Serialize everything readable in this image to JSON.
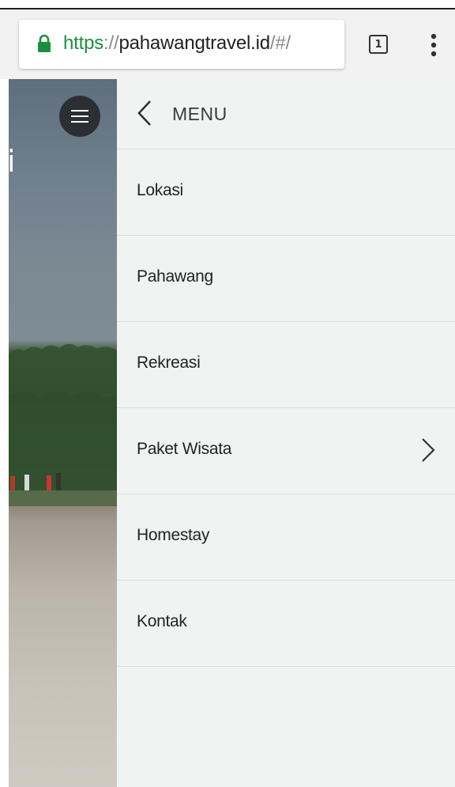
{
  "browser": {
    "url": {
      "scheme": "https",
      "separator": "://",
      "host": "pahawangtravel.id",
      "path": "/#/"
    },
    "tab_count": "1",
    "icons": [
      "lock-icon",
      "tab-switcher-icon",
      "overflow-menu-icon"
    ],
    "colors": {
      "secure": "#1e8e3e"
    }
  },
  "page": {
    "hero_fragment": "i",
    "icons": [
      "hamburger-icon"
    ]
  },
  "menu": {
    "title": "MENU",
    "items": [
      {
        "label": "Lokasi"
      },
      {
        "label": "Pahawang"
      },
      {
        "label": "Rekreasi"
      },
      {
        "label": "Paket Wisata",
        "has_submenu": true
      },
      {
        "label": "Homestay"
      },
      {
        "label": "Kontak"
      }
    ],
    "icons": [
      "back-chevron-icon",
      "chevron-right-icon"
    ],
    "colors": {
      "panel_bg": "#f1f3f3",
      "divider": "#dcdcdc"
    }
  }
}
